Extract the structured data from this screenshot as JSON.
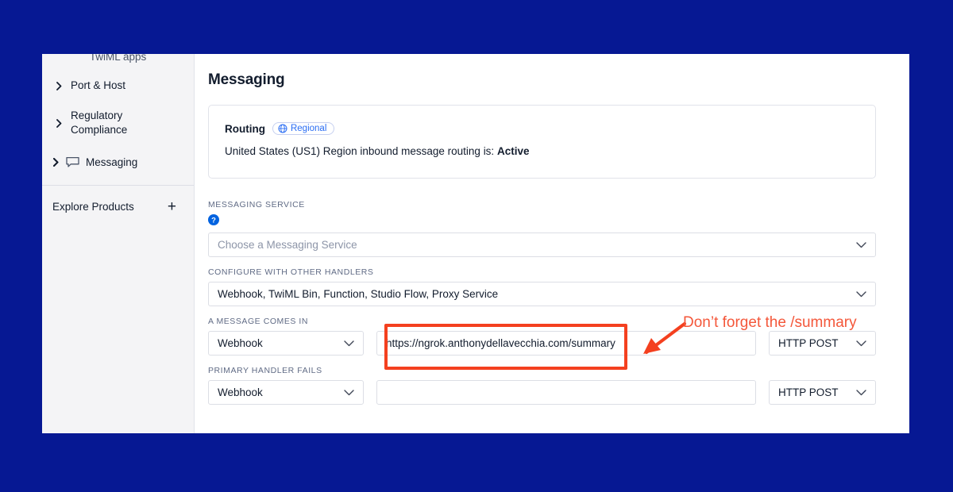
{
  "theme": {
    "page_background": "#061893",
    "panel_background": "#ffffff",
    "sidebar_background": "#f4f4f6",
    "accent_blue": "#2a6df4",
    "annotation_red": "#f4401f",
    "text_dark": "#121c2d",
    "text_muted": "#606b85"
  },
  "sidebar": {
    "clipped_item": {
      "label": "TwiML apps"
    },
    "items": [
      {
        "label": "Port & Host",
        "level": "sub",
        "chevron": "chevron-right-icon",
        "has_icon": false
      },
      {
        "label": "Regulatory Compliance",
        "level": "sub",
        "chevron": "chevron-right-icon",
        "has_icon": false
      },
      {
        "label": "Messaging",
        "level": "top",
        "chevron": "chevron-right-icon",
        "has_icon": true,
        "icon": "speech-bubble-icon"
      }
    ],
    "explore_products": {
      "label": "Explore Products",
      "action_icon": "plus-icon"
    }
  },
  "main": {
    "page_title": "Messaging",
    "routing_card": {
      "label": "Routing",
      "badge": {
        "text": "Regional",
        "icon": "globe-icon"
      },
      "description_prefix": "United States (US1) Region inbound message routing is: ",
      "description_status": "Active"
    },
    "messaging_service": {
      "label": "MESSAGING SERVICE",
      "help_icon": "help-circle-icon",
      "select_value": "Choose a Messaging Service",
      "is_placeholder": true,
      "caret": "chevron-down-icon"
    },
    "other_handlers": {
      "label": "CONFIGURE WITH OTHER HANDLERS",
      "select_value": "Webhook, TwiML Bin, Function, Studio Flow, Proxy Service",
      "caret": "chevron-down-icon"
    },
    "message_comes_in": {
      "label": "A MESSAGE COMES IN",
      "handler_type": "Webhook",
      "url_value": "https://ngrok.anthonydellavecchia.com/summary",
      "url_placeholder": "",
      "method": "HTTP POST",
      "caret": "chevron-down-icon"
    },
    "primary_handler_fails": {
      "label": "PRIMARY HANDLER FAILS",
      "handler_type": "Webhook",
      "url_value": "",
      "url_placeholder": "",
      "method": "HTTP POST",
      "caret": "chevron-down-icon"
    }
  },
  "annotation": {
    "text": "Don’t forget the /summary",
    "arrow_icon": "arrow-down-left-icon",
    "highlight_target": "url-input-message-comes-in"
  }
}
